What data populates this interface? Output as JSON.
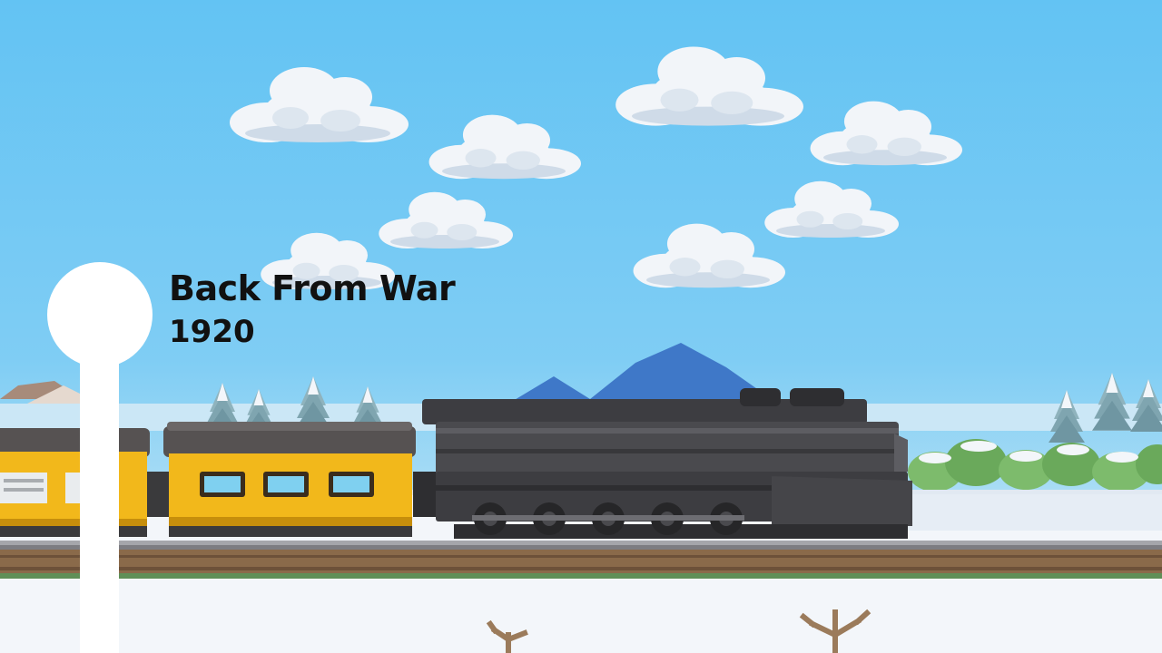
{
  "chapter": {
    "title": "Back From War",
    "year": "1920"
  },
  "colors": {
    "sky_top": "#63c3f3",
    "sky_bottom": "#a8dcf5",
    "cloud": "#f2f5f9",
    "cloud_shade": "#cfdbe8",
    "mountain": "#3f78c8",
    "snow": "#f3f6fa",
    "locomotive": "#4a4a4e",
    "locomotive_dark": "#2e2e31",
    "passenger_car": "#f2b81b",
    "car_roof": "#565252",
    "track_tie": "#8a6a4a",
    "rail": "#7d7d82",
    "pine": "#7fa5b0",
    "bush": "#7dbb6c",
    "timeline": "#ffffff",
    "text": "#111111"
  },
  "scene_elements": [
    "cloud-icon",
    "mountain-icon",
    "pine-tree-icon",
    "bush-icon",
    "locomotive-icon",
    "passenger-car-icon",
    "railroad-track-icon",
    "bare-branch-icon"
  ]
}
